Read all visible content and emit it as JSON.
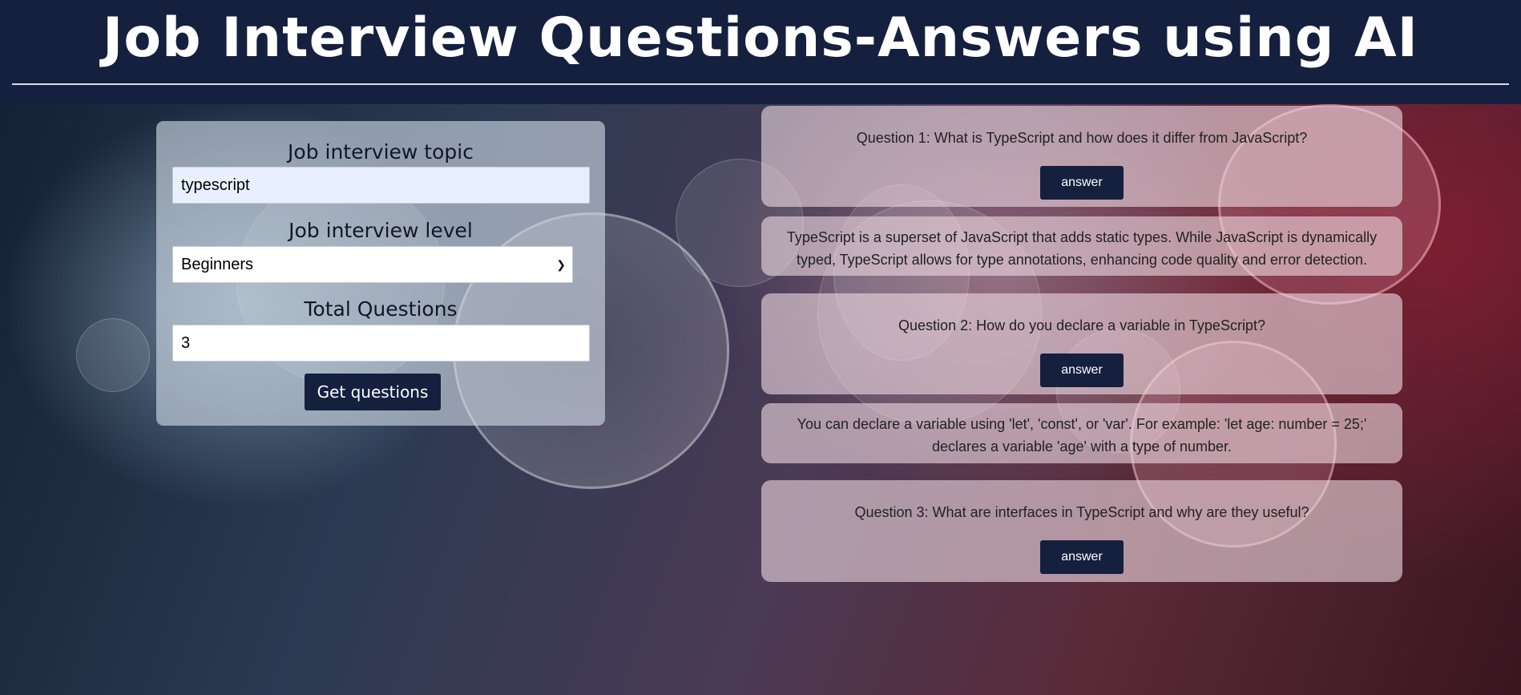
{
  "header": {
    "title": "Job Interview Questions-Answers using AI"
  },
  "form": {
    "topic_label": "Job interview topic",
    "topic_value": "typescript",
    "level_label": "Job interview level",
    "level_value": "Beginners",
    "total_label": "Total Questions",
    "total_value": "3",
    "submit_label": "Get questions"
  },
  "questions": [
    {
      "question": "Question 1: What is TypeScript and how does it differ from JavaScript?",
      "button_label": "answer",
      "answer": "TypeScript is a superset of JavaScript that adds static types. While JavaScript is dynamically typed, TypeScript allows for type annotations, enhancing code quality and error detection."
    },
    {
      "question": "Question 2: How do you declare a variable in TypeScript?",
      "button_label": "answer",
      "answer": "You can declare a variable using 'let', 'const', or 'var'. For example: 'let age: number = 25;' declares a variable 'age' with a type of number."
    },
    {
      "question": "Question 3: What are interfaces in TypeScript and why are they useful?",
      "button_label": "answer",
      "answer": ""
    }
  ],
  "colors": {
    "header_bg": "#15203f",
    "button_bg": "#15203f",
    "accent_red": "#8c1e32"
  }
}
